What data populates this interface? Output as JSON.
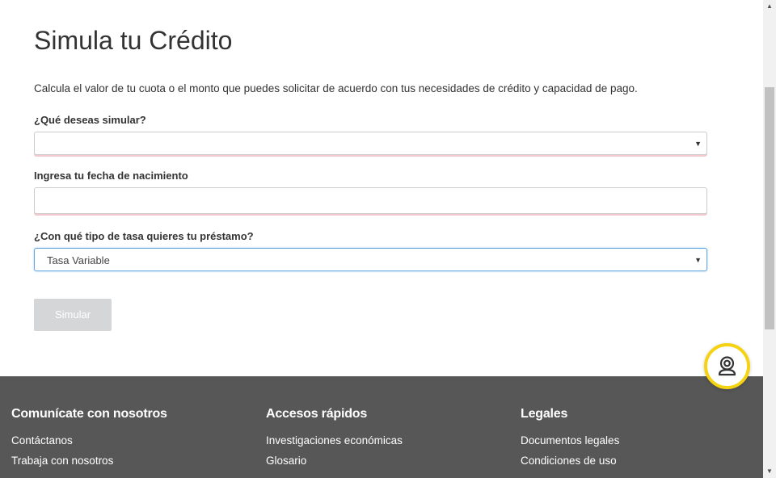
{
  "page": {
    "title": "Simula tu Crédito",
    "intro": "Calcula el valor de tu cuota o el monto que puedes solicitar de acuerdo con tus necesidades de crédito y capacidad de pago."
  },
  "form": {
    "simulate_label": "¿Qué deseas simular?",
    "simulate_value": "",
    "birthdate_label": "Ingresa tu fecha de nacimiento",
    "birthdate_value": "",
    "rate_label": "¿Con qué tipo de tasa quieres tu préstamo?",
    "rate_value": "Tasa Variable",
    "submit_label": "Simular"
  },
  "footer": {
    "contact": {
      "title": "Comunícate con nosotros",
      "links": [
        "Contáctanos",
        "Trabaja con nosotros"
      ]
    },
    "quick": {
      "title": "Accesos rápidos",
      "links": [
        "Investigaciones económicas",
        "Glosario"
      ]
    },
    "legal": {
      "title": "Legales",
      "links": [
        "Documentos legales",
        "Condiciones de uso"
      ]
    }
  },
  "colors": {
    "footer_bg": "#575757",
    "chat_ring": "#f5d312",
    "button_disabled": "#d5d6d8",
    "focus_border": "#66a7e0"
  },
  "icons": {
    "chat": "support-agent-icon",
    "select_caret": "caret-down-icon"
  }
}
